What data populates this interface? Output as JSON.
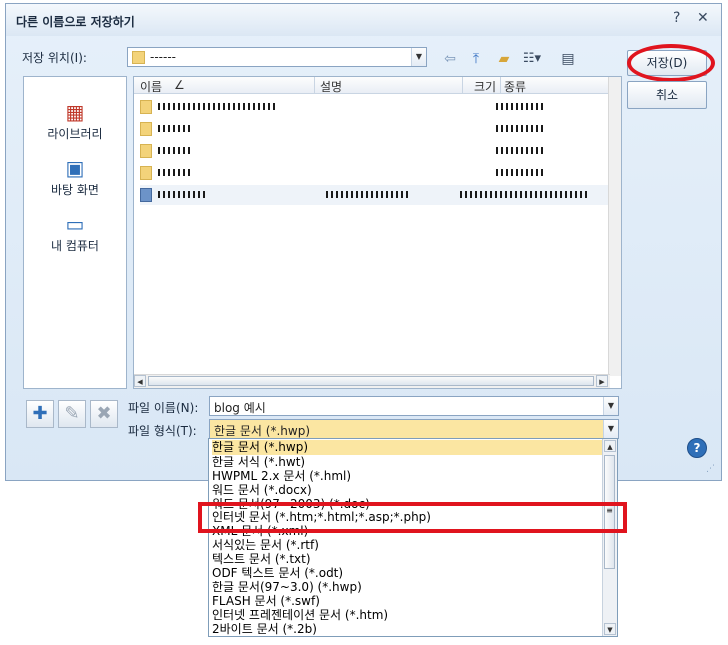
{
  "window": {
    "title": "다른 이름으로 저장하기",
    "help_glyph": "?",
    "close_glyph": "✕"
  },
  "location": {
    "label": "저장 위치(I):",
    "value": "------"
  },
  "places": [
    {
      "label": "라이브러리",
      "icon": "library-icon"
    },
    {
      "label": "바탕 화면",
      "icon": "desktop-icon"
    },
    {
      "label": "내 컴퓨터",
      "icon": "computer-icon"
    }
  ],
  "filelist": {
    "columns": [
      "이름",
      "설명",
      "크기",
      "종류"
    ],
    "sort_indicator": "∠"
  },
  "filename": {
    "label": "파일 이름(N):",
    "value": "blog 예시"
  },
  "filetype": {
    "label": "파일 형식(T):",
    "selected": "한글 문서 (*.hwp)",
    "options": [
      "한글 문서 (*.hwp)",
      "한글 서식 (*.hwt)",
      "HWPML 2.x 문서 (*.hml)",
      "워드 문서 (*.docx)",
      "워드 문서(97~2003) (*.doc)",
      "인터넷 문서 (*.htm;*.html;*.asp;*.php)",
      "XML 문서 (*.xml)",
      "서식있는 문서 (*.rtf)",
      "텍스트 문서 (*.txt)",
      "ODF 텍스트 문서 (*.odt)",
      "한글 문서(97~3.0) (*.hwp)",
      "FLASH 문서 (*.swf)",
      "인터넷 프레젠테이션 문서 (*.htm)",
      "2바이트 문서 (*.2b)"
    ]
  },
  "buttons": {
    "save": "저장(D)",
    "cancel": "취소",
    "help": "?"
  },
  "colors": {
    "highlight_red": "#e0141e",
    "selected_item": "#fbe6a2"
  }
}
